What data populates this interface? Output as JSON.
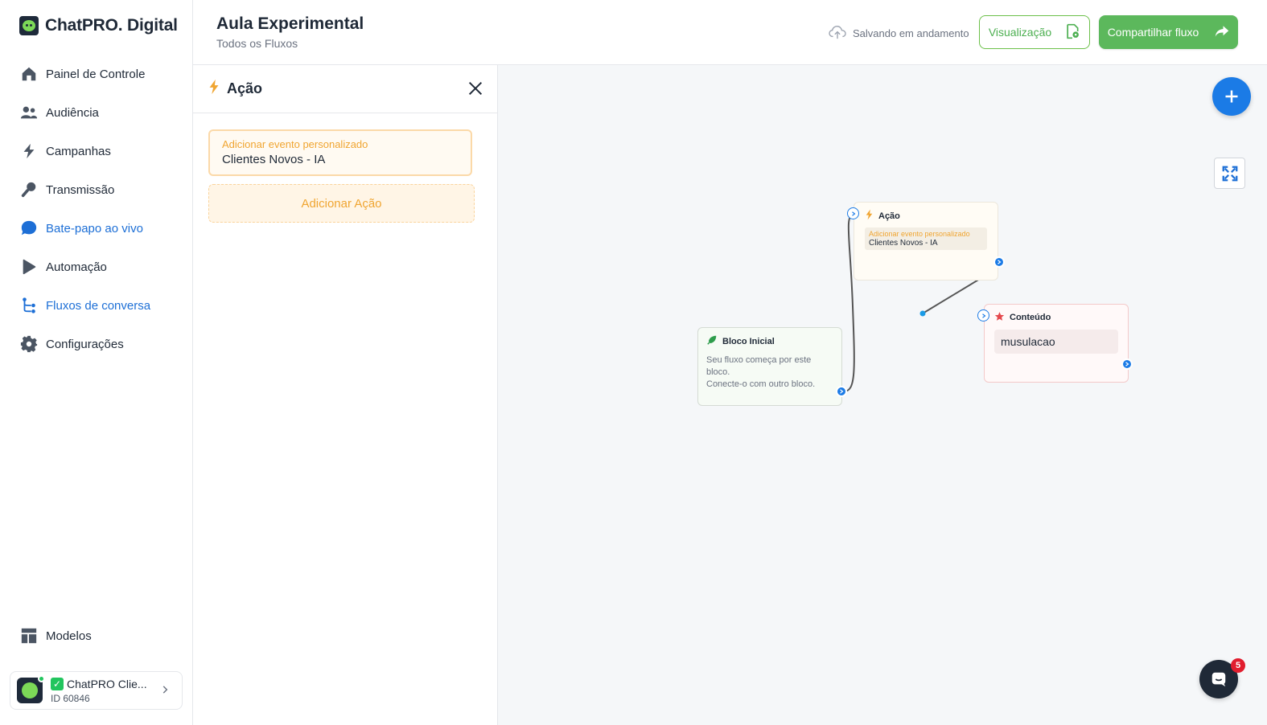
{
  "brand": {
    "name": "ChatPRO. Digital"
  },
  "nav": {
    "items": [
      {
        "label": "Painel de Controle",
        "icon": "home-icon"
      },
      {
        "label": "Audiência",
        "icon": "users-icon"
      },
      {
        "label": "Campanhas",
        "icon": "bolt-icon"
      },
      {
        "label": "Transmissão",
        "icon": "broadcast-icon"
      },
      {
        "label": "Bate-papo ao vivo",
        "icon": "chat-bubble-icon",
        "active": true
      },
      {
        "label": "Automação",
        "icon": "play-icon"
      },
      {
        "label": "Fluxos de conversa",
        "icon": "flow-icon",
        "active": true
      },
      {
        "label": "Configurações",
        "icon": "gear-icon"
      }
    ],
    "bottom": {
      "label": "Modelos",
      "icon": "templates-icon"
    }
  },
  "account": {
    "check": "✓",
    "name": "ChatPRO Clie...",
    "id": "ID 60846"
  },
  "header": {
    "title": "Aula Experimental",
    "subtitle": "Todos os Fluxos",
    "saving": "Salvando em andamento",
    "preview_label": "Visualização",
    "share_label": "Compartilhar fluxo"
  },
  "panel": {
    "title": "Ação",
    "event_label": "Adicionar evento personalizado",
    "event_value": "Clientes Novos - IA",
    "add_action_label": "Adicionar Ação"
  },
  "canvas": {
    "nodes": {
      "start": {
        "title": "Bloco Inicial",
        "desc_line1": "Seu fluxo começa por este bloco.",
        "desc_line2": "Conecte-o com outro bloco."
      },
      "action": {
        "title": "Ação",
        "event_label": "Adicionar evento personalizado",
        "event_value": "Clientes Novos - IA"
      },
      "content": {
        "title": "Conteúdo",
        "text": "musulacao"
      }
    }
  },
  "support_chat": {
    "badge": "5"
  },
  "colors": {
    "primary": "#1b7be6",
    "accent_green": "#5cb85c",
    "action_orange": "#f0a531",
    "content_red": "#e5484d",
    "nav_active": "#1d6fd6"
  }
}
